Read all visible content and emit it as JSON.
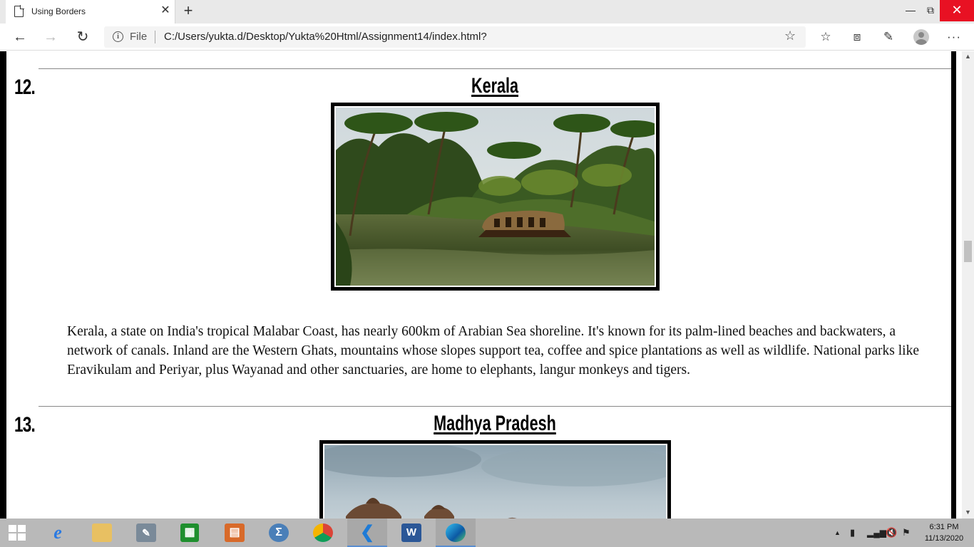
{
  "browser": {
    "tab_title": "Using Borders",
    "tab_close": "✕",
    "new_tab": "+",
    "file_label": "File",
    "url": "C:/Users/yukta.d/Desktop/Yukta%20Html/Assignment14/index.html?"
  },
  "page": {
    "items": [
      {
        "number": "12.",
        "title": "Kerala",
        "image_alt": "Kerala backwaters with houseboat and palm trees",
        "description": "Kerala, a state on India's tropical Malabar Coast, has nearly 600km of Arabian Sea shoreline. It's known for its palm-lined beaches and backwaters, a network of canals. Inland are the Western Ghats, mountains whose slopes support tea, coffee and spice plantations as well as wildlife. National parks like Eravikulam and Periyar, plus Wayanad and other sanctuaries, are home to elephants, langur monkeys and tigers."
      },
      {
        "number": "13.",
        "title": "Madhya Pradesh",
        "image_alt": "Madhya Pradesh monuments under cloudy sky"
      }
    ]
  },
  "taskbar": {
    "apps": [
      "internet-explorer",
      "file-explorer",
      "media-app",
      "store",
      "office-app",
      "calculator-app",
      "chrome",
      "vscode",
      "word",
      "edge"
    ],
    "clock_time": "6:31 PM",
    "clock_date": "11/13/2020"
  }
}
